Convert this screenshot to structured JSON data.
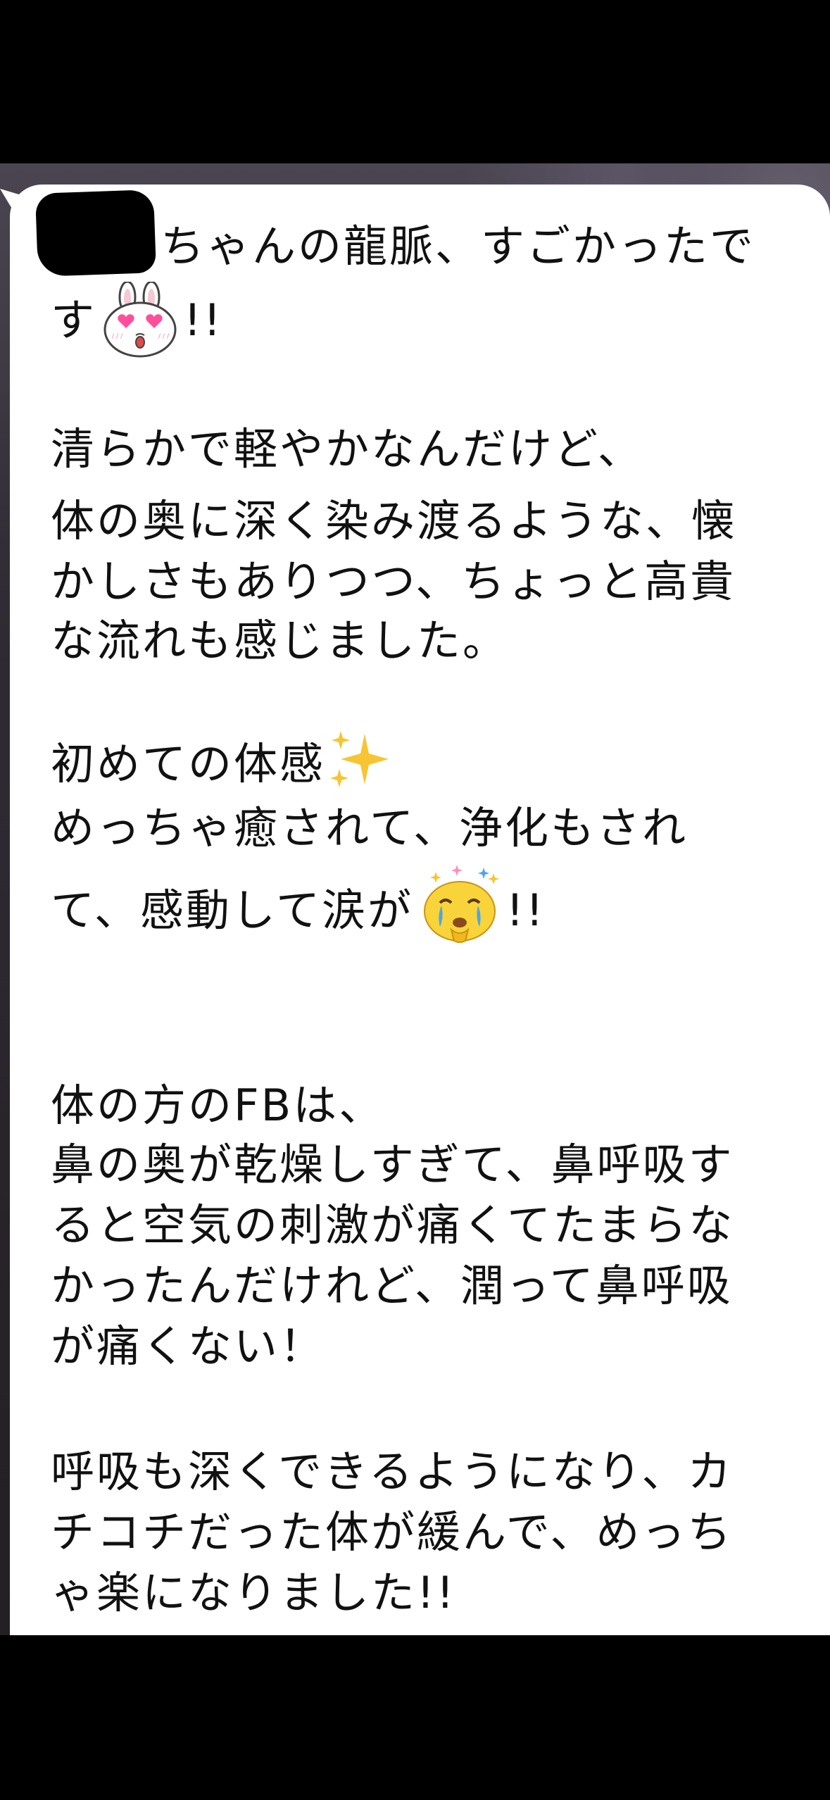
{
  "message": {
    "lines": [
      "ちゃんの龍脈、すごかったで",
      "す",
      "!!",
      "",
      "清らかで軽やかなんだけど、",
      "体の奥に深く染み渡るような、懐",
      "かしさもありつつ、ちょっと高貴",
      "な流れも感じました。",
      "",
      "初めての体感",
      "めっちゃ癒されて、浄化もされ",
      "て、感動して涙が",
      "!!",
      "",
      "",
      "体の方のFBは、",
      "鼻の奥が乾燥しすぎて、鼻呼吸す",
      "ると空気の刺激が痛くてたまらな",
      "かったんだけれど、潤って鼻呼吸",
      "が痛くない！",
      "",
      "呼吸も深くできるようになり、カ",
      "チコチだった体が緩んで、めっち",
      "ゃ楽になりました",
      "!!"
    ],
    "stickers": {
      "bunny": "bunny-heart-eyes-sticker",
      "sparkles": "sparkles-emoji",
      "crying": "crying-tears-sticker"
    },
    "colors": {
      "bubble": "#ffffff",
      "text": "#111111",
      "heart": "#ff4f9a",
      "sparkle_yellow": "#f7c531",
      "crying_face": "#f9d33a",
      "tears": "#4aa6e8"
    }
  }
}
